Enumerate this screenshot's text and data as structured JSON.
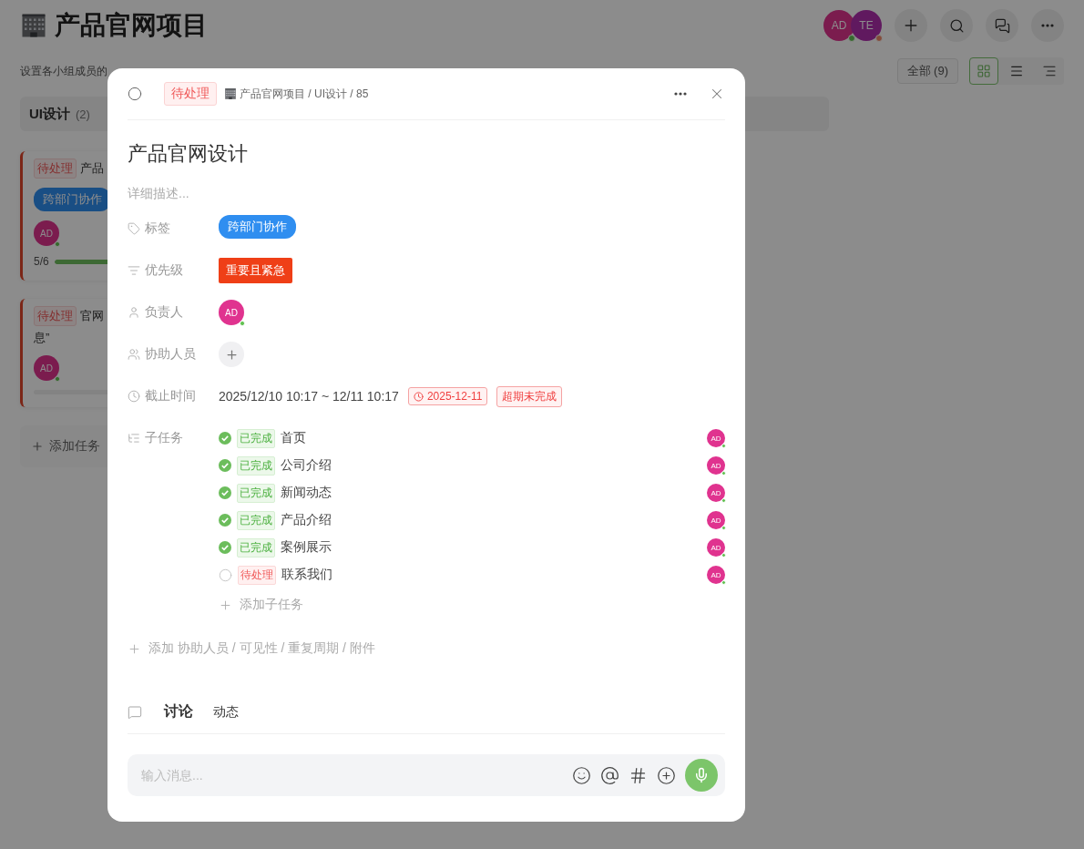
{
  "page": {
    "title": "产品官网项目",
    "description": "设置各小组成员的",
    "members": [
      {
        "initials": "AD"
      },
      {
        "initials": "TE"
      }
    ],
    "filter": "全部 (9)",
    "views": [
      {
        "kind": "board",
        "selected": true
      },
      {
        "kind": "list",
        "selected": false
      },
      {
        "kind": "gantt",
        "selected": false
      }
    ]
  },
  "column": {
    "title": "UI设计",
    "count": "(2)",
    "add_label": "添加任务",
    "cards": [
      {
        "status": "待处理",
        "title_lines": [
          "产品"
        ],
        "tag": "跨部门协作",
        "assignee": "AD",
        "progress": "5/6",
        "level": 0.83
      },
      {
        "status": "待处理",
        "title_lines": [
          "官网",
          "息”"
        ],
        "assignee": "AD"
      }
    ]
  },
  "task": {
    "checked": false,
    "status": "待处理",
    "breadcrumb": "产品官网项目 / UI设计 / 85",
    "title": "产品官网设计",
    "description_placeholder": "详细描述...",
    "fields": [
      {
        "kind": "tag",
        "label": "标签",
        "value": "跨部门协作"
      },
      {
        "kind": "priority",
        "label": "优先级",
        "value": "重要且紧急"
      },
      {
        "kind": "assignee",
        "label": "负责人",
        "initials": "AD"
      },
      {
        "kind": "helpers",
        "label": "协助人员"
      },
      {
        "kind": "deadline",
        "label": "截止时间",
        "value": "2025/12/10 10:17 ~ 12/11 10:17",
        "due": "2025-12-11",
        "overdue": "超期未完成"
      },
      {
        "kind": "subtasks",
        "label": "子任务"
      }
    ],
    "subtasks": [
      {
        "done": true,
        "status": "已完成",
        "title": "首页",
        "assignee": "AD"
      },
      {
        "done": true,
        "status": "已完成",
        "title": "公司介绍",
        "assignee": "AD"
      },
      {
        "done": true,
        "status": "已完成",
        "title": "新闻动态",
        "assignee": "AD"
      },
      {
        "done": true,
        "status": "已完成",
        "title": "产品介绍",
        "assignee": "AD"
      },
      {
        "done": true,
        "status": "已完成",
        "title": "案例展示",
        "assignee": "AD"
      },
      {
        "done": false,
        "status": "待处理",
        "title": "联系我们",
        "assignee": "AD"
      }
    ],
    "add_subtask": "添加子任务",
    "add_more": "添加 协助人员 / 可见性 / 重复周期 / 附件",
    "tabs": [
      {
        "label": "讨论",
        "selected": true
      },
      {
        "label": "动态",
        "selected": false
      }
    ],
    "message_placeholder": "输入消息..."
  }
}
